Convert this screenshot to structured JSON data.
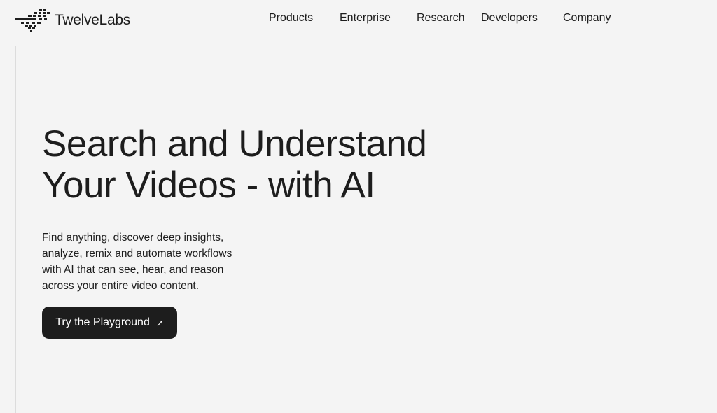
{
  "brand": {
    "name": "TwelveLabs",
    "logo_icon": "twelvelabs-logo-icon"
  },
  "nav": {
    "items": [
      {
        "label": "Products"
      },
      {
        "label": "Enterprise"
      },
      {
        "label": "Research"
      },
      {
        "label": "Developers"
      },
      {
        "label": "Company"
      }
    ]
  },
  "hero": {
    "title_lines": [
      "Search and Understand",
      "Your Videos - with AI"
    ],
    "description_lines": [
      "Find anything, discover deep insights,",
      "analyze, remix and automate workflows",
      "with AI that can see, hear, and reason",
      "across your entire video content."
    ],
    "cta": {
      "label": "Try the Playground",
      "icon": "arrow-up-right-icon",
      "icon_glyph": "↗"
    }
  },
  "colors": {
    "background": "#f4f4f4",
    "text": "#1d1d1d",
    "button_bg": "#1d1d1d",
    "button_text": "#ffffff"
  }
}
